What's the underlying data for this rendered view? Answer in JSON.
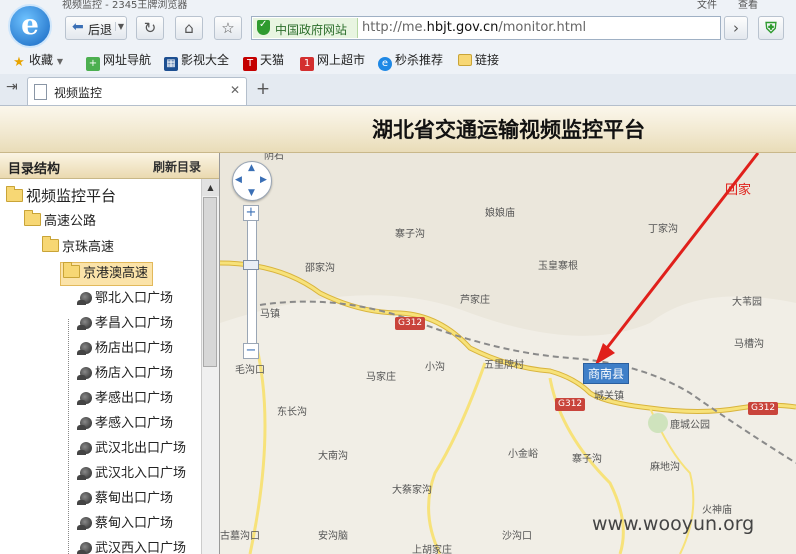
{
  "browser": {
    "window_title": "视频监控 - 2345王牌浏览器",
    "menu_file": "文件",
    "menu_view": "查看",
    "back_label": "后退",
    "gov_badge": "中国政府网站",
    "url_prefix": "http://me.",
    "url_domain": "hbjt.gov.cn",
    "url_suffix": "/monitor.html",
    "bookmarks": [
      "收藏",
      "网址导航",
      "影视大全",
      "天猫",
      "网上超市",
      "秒杀推荐",
      "链接"
    ],
    "tab_title": "视频监控"
  },
  "page": {
    "title": "湖北省交通运输视频监控平台"
  },
  "sidebar": {
    "title": "目录结构",
    "refresh": "刷新目录",
    "tree": {
      "root": "视频监控平台",
      "level1": "高速公路",
      "level2": "京珠高速",
      "level3_selected": "京港澳高速",
      "cameras": [
        "鄂北入口广场",
        "孝昌入口广场",
        "杨店出口广场",
        "杨店入口广场",
        "孝感出口广场",
        "孝感入口广场",
        "武汉北出口广场",
        "武汉北入口广场",
        "蔡甸出口广场",
        "蔡甸入口广场",
        "武汉西入口广场"
      ]
    }
  },
  "map": {
    "places": [
      "阴石",
      "寨子沟",
      "娘娘庙",
      "丁家沟",
      "邵家沟",
      "玉皇寨根",
      "芦家庄",
      "大苇园",
      "马槽沟",
      "马家庄",
      "小沟",
      "五里牌村",
      "城关镇",
      "鹿城公园",
      "东长沟",
      "大南沟",
      "小金峪",
      "寨子沟",
      "麻地沟",
      "大蔡家沟",
      "火神庙",
      "安沟脑",
      "沙沟口",
      "上胡家庄",
      "毛沟口",
      "马镇",
      "古墓沟口"
    ],
    "road_labels": [
      "G312",
      "G312",
      "G312"
    ],
    "city": "商南县",
    "home_marker": "回家",
    "watermark": "www.wooyun.org"
  }
}
